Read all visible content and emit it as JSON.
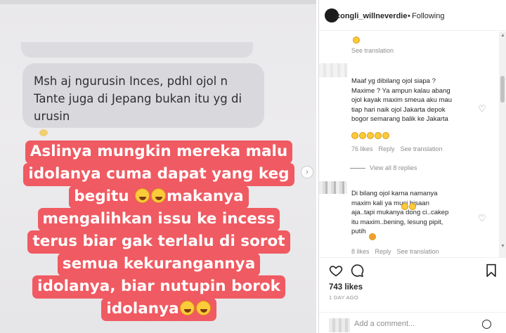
{
  "post": {
    "chat_bubble_text": "Msh aj ngurusin Inces, pdhl ojol n\nTante juga di Jepang bukan itu yg di\nurusin",
    "caption_lines": [
      "Aslinya mungkin mereka malu",
      "idolanya cuma dapat yang keg",
      "begitu",
      "makanya",
      "mengalihkan issu ke incess",
      "terus biar gak terlalu di sorot",
      "semua kekurangannya",
      "idolanya, biar nutupin borok",
      "idolanya"
    ],
    "next_arrow": "›"
  },
  "header": {
    "username": "congli_willneverdie",
    "separator": "•",
    "follow_status": "Following"
  },
  "comments": [
    {
      "see_translation": "See translation"
    },
    {
      "text": "Maaf yg dibilang ojol siapa ?\nMaxime ? Ya ampun kalau abang\nojol kayak maxim smeua aku mau\ntiap hari naik ojol Jakarta depok\nbogor semarang balik ke Jakarta",
      "likes": "76 likes",
      "reply": "Reply",
      "see_translation": "See translation"
    },
    {
      "text": "Di bilang ojol karna namanya\nmaxim kali ya     muci bisaan\naja..tapi mukanya dong ci..cakep\nitu maxim..bening, lesung pipit,\nputih",
      "likes": "8 likes",
      "reply": "Reply",
      "see_translation": "See translation"
    }
  ],
  "view_all_replies": "View all 8 replies",
  "likes_total": "743 likes",
  "post_date": "1 DAY AGO",
  "add_comment_placeholder": "Add a comment...",
  "icons": {
    "heart": "heart-icon",
    "comment": "comment-icon",
    "bookmark": "bookmark-icon",
    "emoji": "emoji-icon"
  },
  "colors": {
    "caption_highlight": "#f05a62",
    "chat_bubble": "#d9d9dd",
    "muted_text": "#8e8e8e"
  }
}
